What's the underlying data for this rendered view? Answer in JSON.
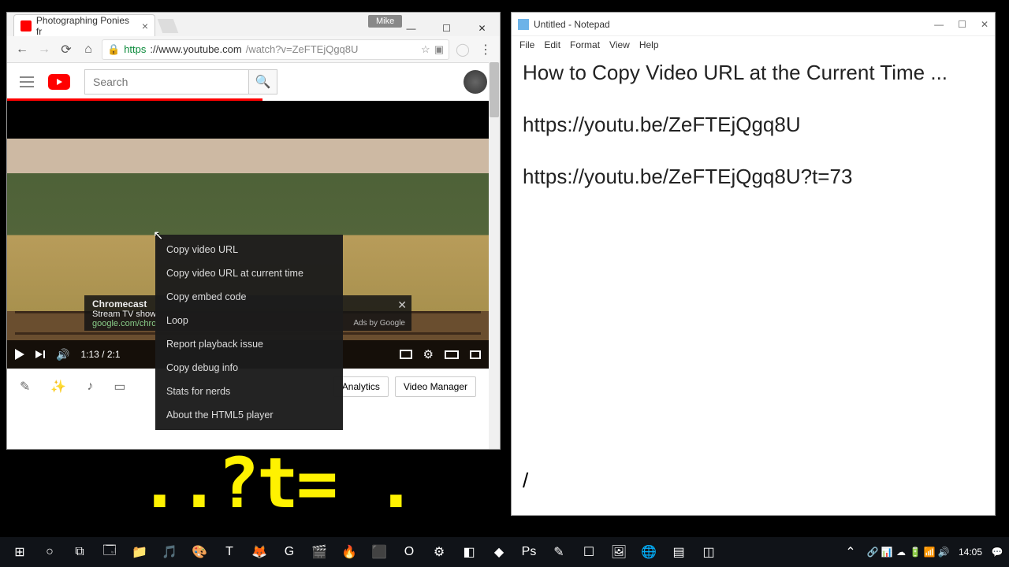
{
  "chrome": {
    "tab_title": "Photographing Ponies fr",
    "user_tag": "Mike",
    "url_protocol": "https",
    "url_domain": "://www.youtube.com",
    "url_path": "/watch?v=ZeFTEjQgq8U",
    "search_placeholder": "Search",
    "time_elapsed": "1:13",
    "time_total": "2:1",
    "ad_title": "Chromecast",
    "ad_text1": "Stream TV show",
    "ad_text2": "google.com/chro",
    "ad_by": "Ads by Google",
    "action_analytics": "Analytics",
    "action_vidmgr": "Video Manager"
  },
  "context_menu": [
    "Copy video URL",
    "Copy video URL at current time",
    "Copy embed code",
    "Loop",
    "Report playback issue",
    "Copy debug info",
    "Stats for nerds",
    "About the HTML5 player"
  ],
  "notepad": {
    "title": "Untitled - Notepad",
    "menu": [
      "File",
      "Edit",
      "Format",
      "View",
      "Help"
    ],
    "line1": "How to Copy Video URL at the Current Time ...",
    "line2": "https://youtu.be/ZeFTEjQgq8U",
    "line3": "https://youtu.be/ZeFTEjQgq8U?t=73",
    "cursor_line": "/"
  },
  "overlay": "..?t=  .",
  "taskbar": {
    "clock": "14:05"
  }
}
